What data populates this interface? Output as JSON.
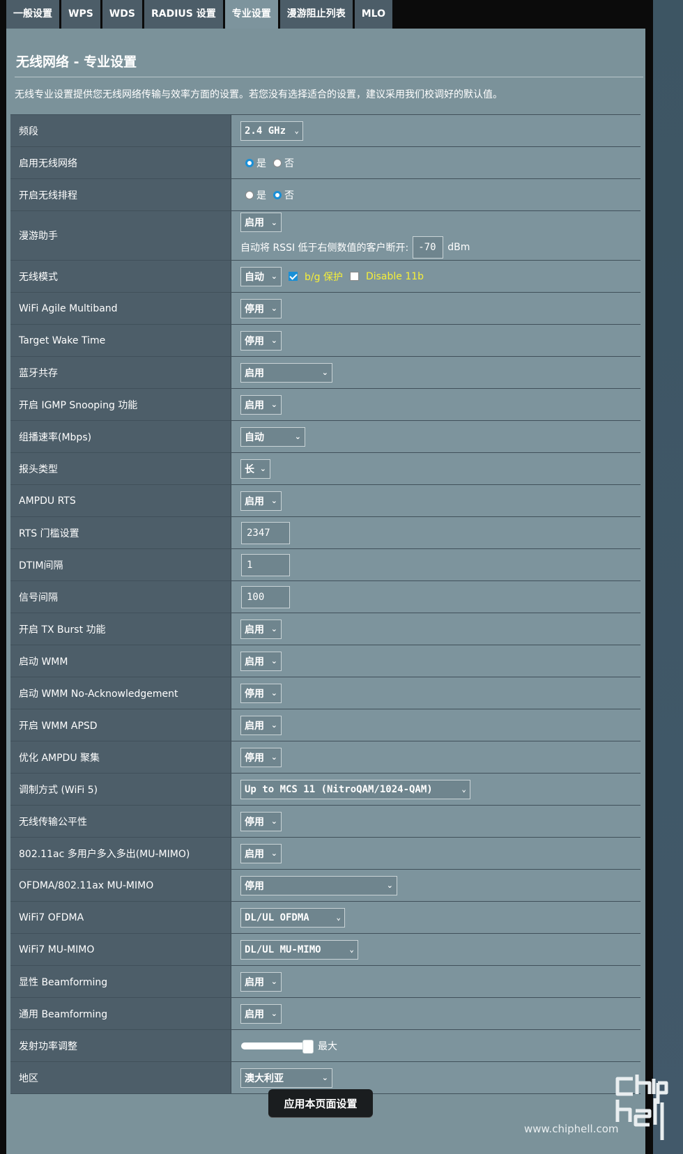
{
  "tabs": [
    "一般设置",
    "WPS",
    "WDS",
    "RADIUS 设置",
    "专业设置",
    "漫游阻止列表",
    "MLO"
  ],
  "active_tab_index": 4,
  "page_title": "无线网络 - 专业设置",
  "description": "无线专业设置提供您无线网络传输与效率方面的设置。若您没有选择适合的设置，建议采用我们校调好的默认值。",
  "rows": {
    "band": {
      "label": "频段",
      "value": "2.4 GHz"
    },
    "enable_wireless": {
      "label": "启用无线网络",
      "opt_yes": "是",
      "opt_no": "否",
      "selected": "是"
    },
    "wireless_schedule": {
      "label": "开启无线排程",
      "opt_yes": "是",
      "opt_no": "否",
      "selected": "否"
    },
    "roaming": {
      "label": "漫游助手",
      "value": "启用",
      "rssi_text": "自动将 RSSI 低于右侧数值的客户断开:",
      "rssi_value": "-70",
      "rssi_unit": "dBm"
    },
    "wireless_mode": {
      "label": "无线模式",
      "value": "自动",
      "bg_protect": "b/g 保护",
      "bg_protect_checked": true,
      "disable_11b": "Disable 11b",
      "disable_11b_checked": false
    },
    "agile_multiband": {
      "label": "WiFi Agile Multiband",
      "value": "停用"
    },
    "twt": {
      "label": "Target Wake Time",
      "value": "停用"
    },
    "bt_coex": {
      "label": "蓝牙共存",
      "value": "启用"
    },
    "igmp": {
      "label": "开启 IGMP Snooping 功能",
      "value": "启用"
    },
    "multicast_rate": {
      "label": "组播速率(Mbps)",
      "value": "自动"
    },
    "preamble": {
      "label": "报头类型",
      "value": "长"
    },
    "ampdu_rts": {
      "label": "AMPDU RTS",
      "value": "启用"
    },
    "rts_threshold": {
      "label": "RTS 门槛设置",
      "value": "2347"
    },
    "dtim": {
      "label": "DTIM间隔",
      "value": "1"
    },
    "beacon": {
      "label": "信号间隔",
      "value": "100"
    },
    "tx_burst": {
      "label": "开启 TX Burst 功能",
      "value": "启用"
    },
    "wmm": {
      "label": "启动 WMM",
      "value": "启用"
    },
    "wmm_noack": {
      "label": "启动 WMM No-Acknowledgement",
      "value": "停用"
    },
    "wmm_apsd": {
      "label": "开启 WMM APSD",
      "value": "启用"
    },
    "ampdu_agg": {
      "label": "优化 AMPDU 聚集",
      "value": "停用"
    },
    "modulation": {
      "label": "调制方式 (WiFi 5)",
      "value": "Up to MCS 11 (NitroQAM/1024-QAM)"
    },
    "airtime_fairness": {
      "label": "无线传输公平性",
      "value": "停用"
    },
    "mu_mimo_11ac": {
      "label": "802.11ac 多用户多入多出(MU-MIMO)",
      "value": "启用"
    },
    "ofdma_11ax": {
      "label": "OFDMA/802.11ax MU-MIMO",
      "value": "停用"
    },
    "wifi7_ofdma": {
      "label": "WiFi7 OFDMA",
      "value": "DL/UL OFDMA"
    },
    "wifi7_mumimo": {
      "label": "WiFi7 MU-MIMO",
      "value": "DL/UL MU-MIMO"
    },
    "explicit_bf": {
      "label": "显性 Beamforming",
      "value": "启用"
    },
    "universal_bf": {
      "label": "通用 Beamforming",
      "value": "启用"
    },
    "tx_power": {
      "label": "发射功率调整",
      "level_text": "最大",
      "level_fraction": 1.0
    },
    "region": {
      "label": "地区",
      "value": "澳大利亚"
    }
  },
  "apply_button": "应用本页面设置",
  "watermark": {
    "url": "www.chiphell.com"
  },
  "colors": {
    "tab_bg": "#4c5d68",
    "panel_bg": "#7b929a",
    "label_bg": "#4d5e69",
    "value_bg": "#7d949d",
    "radio_on": "#1a8fd6",
    "highlight_text": "#f6ef38"
  }
}
